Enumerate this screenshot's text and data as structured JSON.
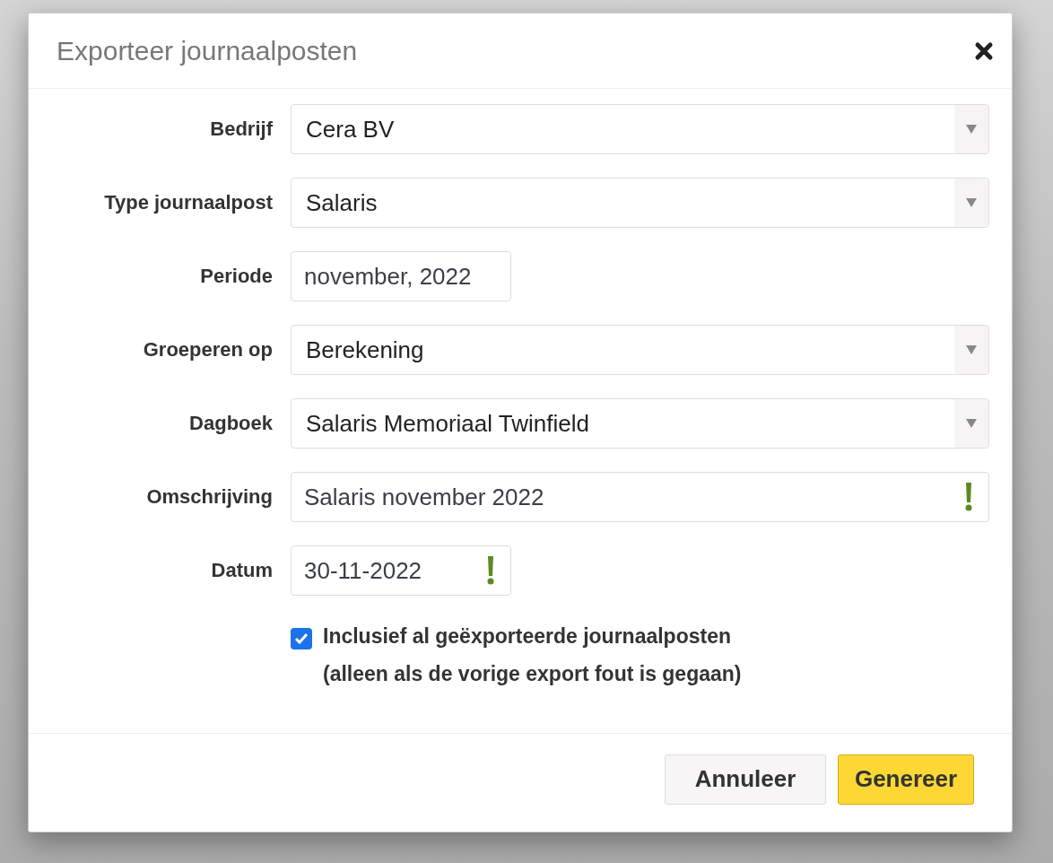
{
  "dialog": {
    "title": "Exporteer journaalposten"
  },
  "fields": [
    {
      "label": "Bedrijf",
      "kind": "select",
      "value": "Cera BV",
      "warning": false
    },
    {
      "label": "Type journaalpost",
      "kind": "select",
      "value": "Salaris",
      "warning": false
    },
    {
      "label": "Periode",
      "kind": "month",
      "value": "november, 2022",
      "warning": false
    },
    {
      "label": "Groeperen op",
      "kind": "select",
      "value": "Berekening",
      "warning": false
    },
    {
      "label": "Dagboek",
      "kind": "select",
      "value": "Salaris Memoriaal Twinfield",
      "warning": false
    },
    {
      "label": "Omschrijving",
      "kind": "text",
      "value": "Salaris november 2022",
      "warning": true
    },
    {
      "label": "Datum",
      "kind": "date",
      "value": "30-11-2022",
      "warning": true
    }
  ],
  "checkbox": {
    "label": "Inclusief al geëxporteerde journaalposten",
    "note": "(alleen als de vorige export fout is gegaan)",
    "checked": true
  },
  "buttons": [
    {
      "label": "Annuleer",
      "kind": "secondary"
    },
    {
      "label": "Genereer",
      "kind": "primary"
    }
  ]
}
